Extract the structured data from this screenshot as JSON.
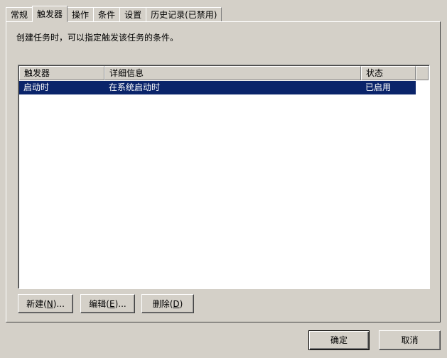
{
  "tabs": [
    {
      "label": "常规",
      "active": false
    },
    {
      "label": "触发器",
      "active": true
    },
    {
      "label": "操作",
      "active": false
    },
    {
      "label": "条件",
      "active": false
    },
    {
      "label": "设置",
      "active": false
    },
    {
      "label": "历史记录(已禁用)",
      "active": false
    }
  ],
  "description": "创建任务时，可以指定触发该任务的条件。",
  "list": {
    "columns": [
      "触发器",
      "详细信息",
      "状态"
    ],
    "rows": [
      {
        "trigger": "启动时",
        "details": "在系统启动时",
        "status": "已启用",
        "selected": true
      }
    ]
  },
  "buttons": {
    "new": {
      "text": "新建(",
      "key": "N",
      "suffix": ")..."
    },
    "edit": {
      "text": "编辑(",
      "key": "E",
      "suffix": ")..."
    },
    "delete": {
      "text": "删除(",
      "key": "D",
      "suffix": ")"
    },
    "ok": "确定",
    "cancel": "取消"
  },
  "colors": {
    "selection": "#0a246a",
    "face": "#d4d0c8"
  }
}
